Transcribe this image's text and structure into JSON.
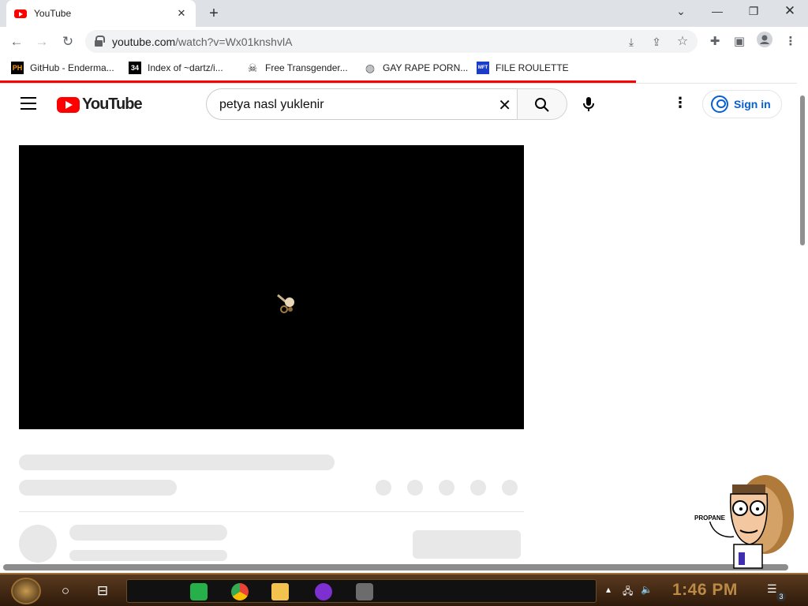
{
  "browser": {
    "tab_title": "YouTube",
    "url_host": "youtube.com",
    "url_path": "/watch?v=Wx01knshvlA",
    "bookmarks": [
      {
        "label": "GitHub - Enderma...",
        "icon": "PH",
        "icon_name": "pornhub-favicon",
        "color": "#f7971d"
      },
      {
        "label": "Index of ~dartz/i...",
        "icon": "34",
        "icon_name": "qr-favicon",
        "color": "#000000"
      },
      {
        "label": "Free Transgender...",
        "icon": "",
        "icon_name": "skull-favicon",
        "color": "#333333"
      },
      {
        "label": "GAY RAPE PORN...",
        "icon": "",
        "icon_name": "globe-icon",
        "color": "#5f6368"
      },
      {
        "label": "FILE ROULETTE",
        "icon": "MFT",
        "icon_name": "file-roulette-favicon",
        "color": "#1a3cc7"
      }
    ]
  },
  "youtube": {
    "logo_text": "YouTube",
    "search_value": "petya nasl yuklenir",
    "signin_label": "Sign in",
    "accent": "#ff0000",
    "link_color": "#065fd4"
  },
  "overlay": {
    "propane_text": "PROPANE"
  },
  "taskbar": {
    "clock": "1:46 PM",
    "notification_count": "3"
  }
}
